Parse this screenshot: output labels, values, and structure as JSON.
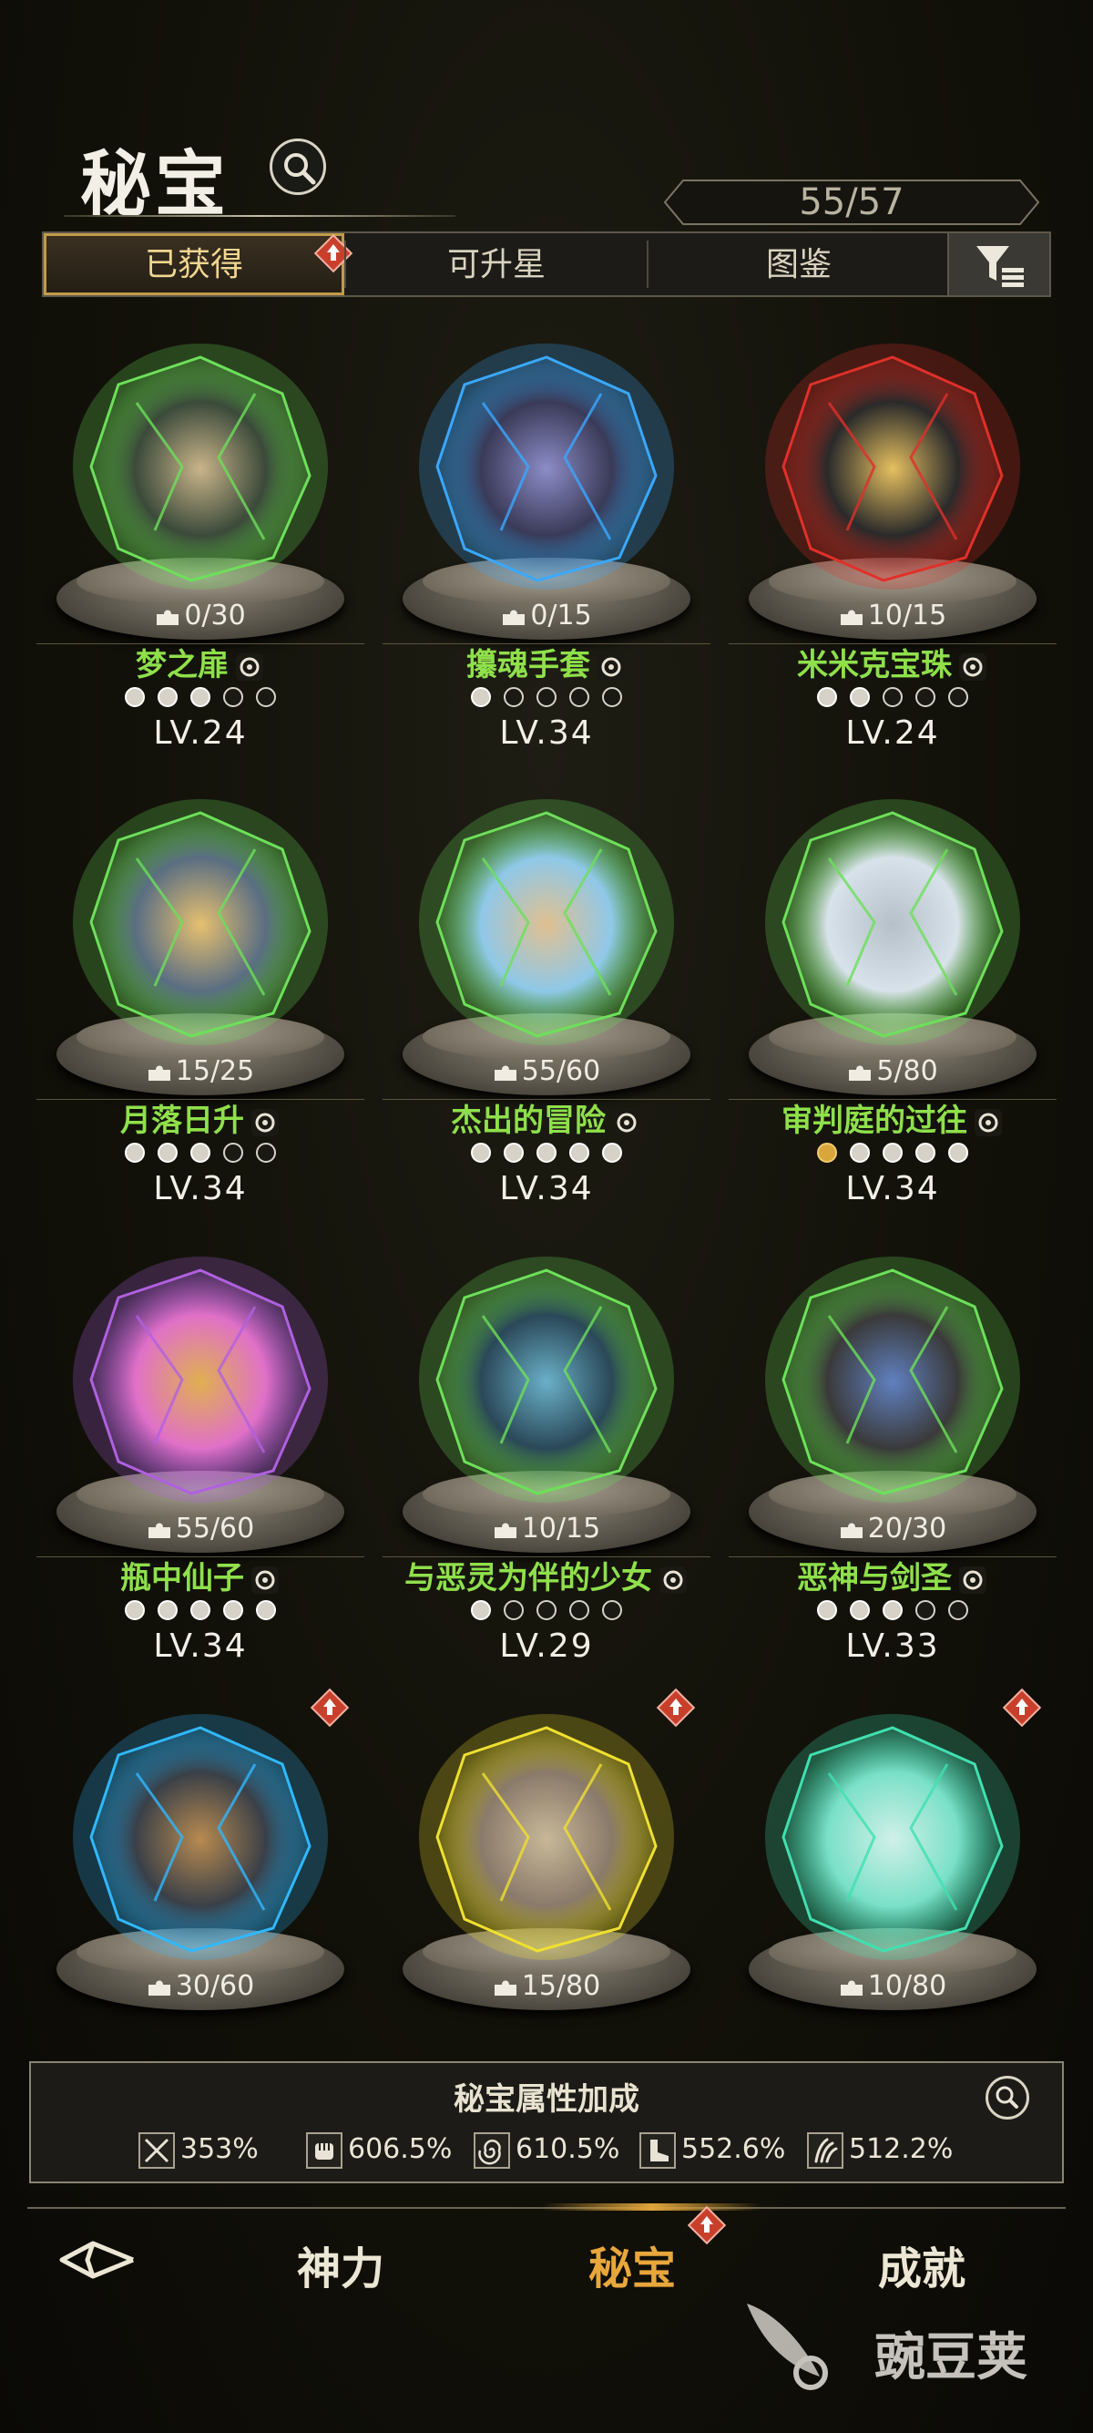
{
  "header": {
    "title": "秘宝",
    "count": "55/57"
  },
  "tabs": [
    {
      "label": "已获得",
      "active": true,
      "badge": true
    },
    {
      "label": "可升星",
      "active": false
    },
    {
      "label": "图鉴",
      "active": false
    }
  ],
  "treasures": [
    {
      "progress": "0/30",
      "name": "梦之扉",
      "class_icon": "spiral-icon",
      "stars": [
        "on",
        "on",
        "on",
        "off",
        "off"
      ],
      "level": "LV.24"
    },
    {
      "progress": "0/15",
      "name": "攥魂手套",
      "class_icon": "spiral-icon",
      "stars": [
        "on",
        "off",
        "off",
        "off",
        "off"
      ],
      "level": "LV.34"
    },
    {
      "progress": "10/15",
      "name": "米米克宝珠",
      "class_icon": "fist-icon",
      "stars": [
        "on",
        "on",
        "off",
        "off",
        "off"
      ],
      "level": "LV.24"
    },
    {
      "progress": "15/25",
      "name": "月落日升",
      "class_icon": "fist-icon",
      "stars": [
        "on",
        "on",
        "on",
        "off",
        "off"
      ],
      "level": "LV.34"
    },
    {
      "progress": "55/60",
      "name": "杰出的冒险",
      "class_icon": "boot-icon",
      "stars": [
        "on",
        "on",
        "on",
        "on",
        "on"
      ],
      "level": "LV.34"
    },
    {
      "progress": "5/80",
      "name": "审判庭的过往",
      "class_icon": "claw-icon",
      "stars": [
        "gold",
        "on",
        "on",
        "on",
        "on"
      ],
      "level": "LV.34"
    },
    {
      "progress": "55/60",
      "name": "瓶中仙子",
      "class_icon": "claw-icon",
      "stars": [
        "on",
        "on",
        "on",
        "on",
        "on"
      ],
      "level": "LV.34"
    },
    {
      "progress": "10/15",
      "name": "与恶灵为伴的少女",
      "class_icon": "fist-icon",
      "stars": [
        "on",
        "off",
        "off",
        "off",
        "off"
      ],
      "level": "LV.29"
    },
    {
      "progress": "20/30",
      "name": "恶神与剑圣",
      "class_icon": "spiral-icon",
      "stars": [
        "on",
        "on",
        "on",
        "off",
        "off"
      ],
      "level": "LV.33"
    },
    {
      "progress": "30/60",
      "upgrade": true
    },
    {
      "progress": "15/80",
      "upgrade": true
    },
    {
      "progress": "10/80",
      "upgrade": true
    }
  ],
  "attributes": {
    "title": "秘宝属性加成",
    "items": [
      {
        "icon": "sword-icon",
        "value": "353%"
      },
      {
        "icon": "fist-icon",
        "value": "606.5%"
      },
      {
        "icon": "spiral-icon",
        "value": "610.5%"
      },
      {
        "icon": "boot-icon",
        "value": "552.6%"
      },
      {
        "icon": "claw-icon",
        "value": "512.2%"
      }
    ]
  },
  "nav": {
    "items": [
      {
        "label": "神力"
      },
      {
        "label": "秘宝",
        "active": true
      },
      {
        "label": "成就"
      }
    ]
  },
  "watermark": "豌豆荚",
  "colors": {
    "name_green": "#8fe04b",
    "active_gold": "#e8a73c",
    "badge_red": "#c8402c"
  }
}
